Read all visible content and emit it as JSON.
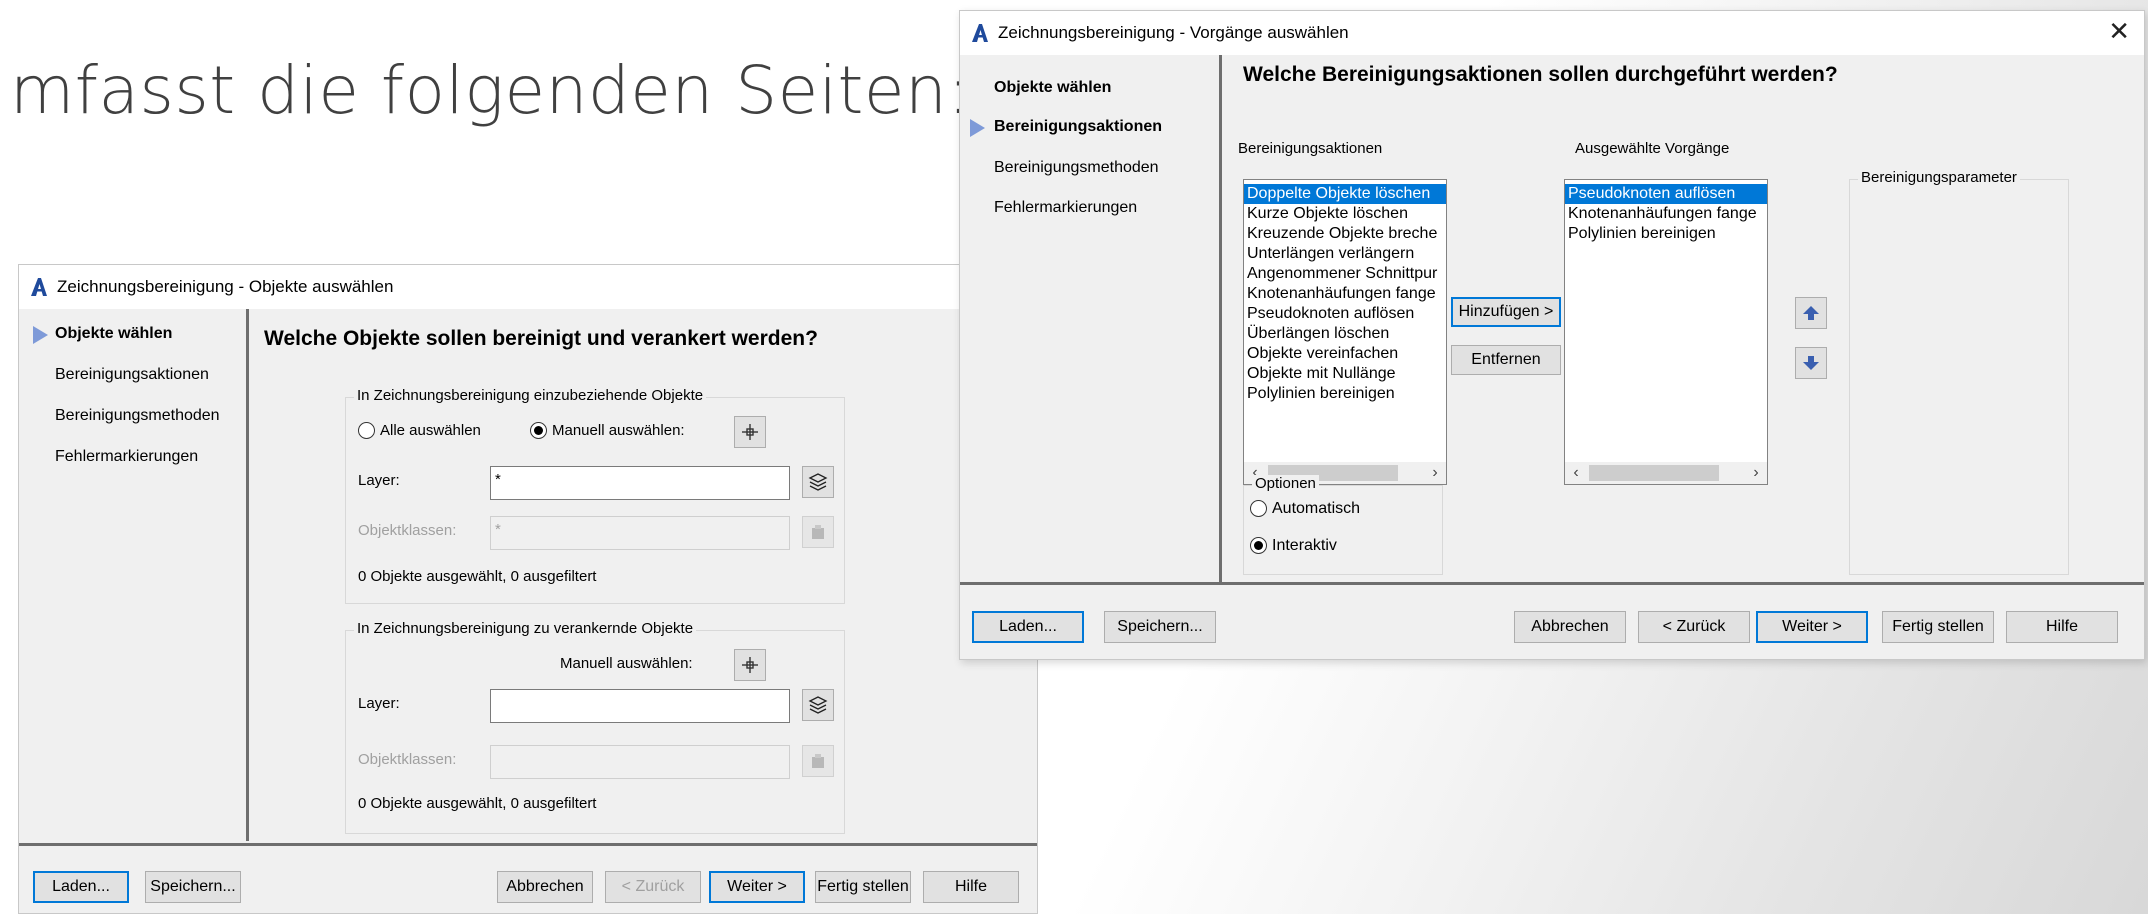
{
  "slide": {
    "text": "mfasst die folgenden Seiten:"
  },
  "dialog1": {
    "title": "Zeichnungsbereinigung - Objekte auswählen",
    "nav": [
      "Objekte wählen",
      "Bereinigungsaktionen",
      "Bereinigungsmethoden",
      "Fehlermarkierungen"
    ],
    "heading": "Welche Objekte sollen bereinigt und verankert werden?",
    "include_group": {
      "legend": "In Zeichnungsbereinigung einzubeziehende Objekte",
      "radio_all": "Alle auswählen",
      "radio_manual": "Manuell auswählen:",
      "layer_label": "Layer:",
      "layer_value": "*",
      "classes_label": "Objektklassen:",
      "classes_value": "*",
      "status": "0 Objekte ausgewählt, 0 ausgefiltert"
    },
    "anchor_group": {
      "legend": "In Zeichnungsbereinigung zu verankernde Objekte",
      "manual_label": "Manuell auswählen:",
      "layer_label": "Layer:",
      "layer_value": "",
      "classes_label": "Objektklassen:",
      "classes_value": "",
      "status": "0 Objekte ausgewählt, 0 ausgefiltert"
    },
    "buttons": {
      "load": "Laden...",
      "save": "Speichern...",
      "cancel": "Abbrechen",
      "back": "< Zurück",
      "next": "Weiter >",
      "finish": "Fertig stellen",
      "help": "Hilfe"
    }
  },
  "dialog2": {
    "title": "Zeichnungsbereinigung - Vorgänge auswählen",
    "nav": [
      "Objekte wählen",
      "Bereinigungsaktionen",
      "Bereinigungsmethoden",
      "Fehlermarkierungen"
    ],
    "heading": "Welche Bereinigungsaktionen sollen durchgeführt werden?",
    "actions_label": "Bereinigungsaktionen",
    "actions": [
      "Doppelte Objekte löschen",
      "Kurze Objekte löschen",
      "Kreuzende Objekte breche",
      "Unterlängen verlängern",
      "Angenommener Schnittpur",
      "Knotenanhäufungen fange",
      "Pseudoknoten auflösen",
      "Überlängen löschen",
      "Objekte vereinfachen",
      "Objekte mit Nullänge",
      "Polylinien bereinigen"
    ],
    "selected_label": "Ausgewählte Vorgänge",
    "selected": [
      "Pseudoknoten auflösen",
      "Knotenanhäufungen fange",
      "Polylinien bereinigen"
    ],
    "add_button": "Hinzufügen >",
    "remove_button": "Entfernen",
    "params_label": "Bereinigungsparameter",
    "options": {
      "legend": "Optionen",
      "auto": "Automatisch",
      "interactive": "Interaktiv"
    },
    "buttons": {
      "load": "Laden...",
      "save": "Speichern...",
      "cancel": "Abbrechen",
      "back": "< Zurück",
      "next": "Weiter >",
      "finish": "Fertig stellen",
      "help": "Hilfe"
    }
  },
  "colors": {
    "accent": "#0078d7",
    "nav_arrow": "#7e9ad8",
    "selection": "#0078d7",
    "brand": "#1f4a9c"
  }
}
